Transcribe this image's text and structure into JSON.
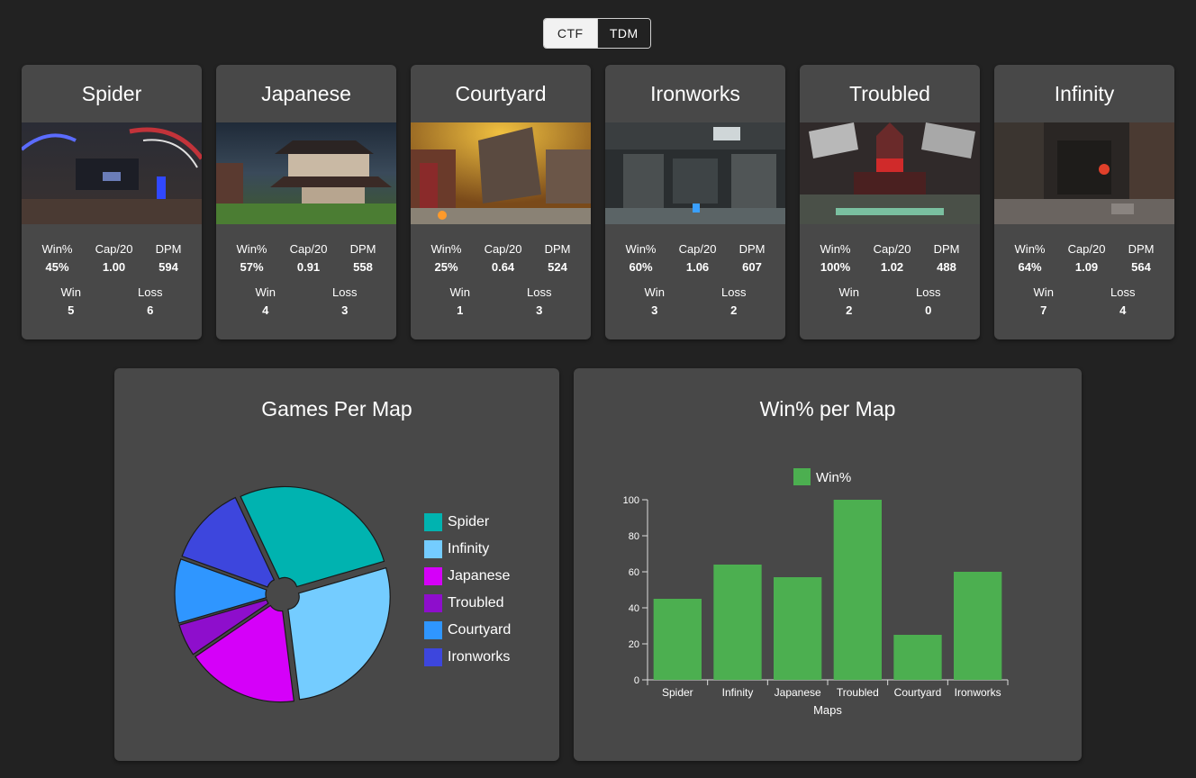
{
  "mode_toggle": {
    "options": [
      "CTF",
      "TDM"
    ],
    "selected": "CTF"
  },
  "maps": [
    {
      "name": "Spider",
      "win_pct": "45%",
      "cap20": "1.00",
      "dpm": "594",
      "win": "5",
      "loss": "6"
    },
    {
      "name": "Japanese",
      "win_pct": "57%",
      "cap20": "0.91",
      "dpm": "558",
      "win": "4",
      "loss": "3"
    },
    {
      "name": "Courtyard",
      "win_pct": "25%",
      "cap20": "0.64",
      "dpm": "524",
      "win": "1",
      "loss": "3"
    },
    {
      "name": "Ironworks",
      "win_pct": "60%",
      "cap20": "1.06",
      "dpm": "607",
      "win": "3",
      "loss": "2"
    },
    {
      "name": "Troubled",
      "win_pct": "100%",
      "cap20": "1.02",
      "dpm": "488",
      "win": "2",
      "loss": "0"
    },
    {
      "name": "Infinity",
      "win_pct": "64%",
      "cap20": "1.09",
      "dpm": "564",
      "win": "7",
      "loss": "4"
    }
  ],
  "stat_labels": {
    "win_pct": "Win%",
    "cap20": "Cap/20",
    "dpm": "DPM",
    "win": "Win",
    "loss": "Loss"
  },
  "chart_data": [
    {
      "type": "pie",
      "title": "Games Per Map",
      "categories": [
        "Spider",
        "Infinity",
        "Japanese",
        "Troubled",
        "Courtyard",
        "Ironworks"
      ],
      "values": [
        11,
        11,
        7,
        2,
        4,
        5
      ],
      "colors": [
        "#00b3b0",
        "#74ccff",
        "#d500f9",
        "#8e0ecc",
        "#2f96ff",
        "#3d46dd"
      ],
      "legend": "right"
    },
    {
      "type": "bar",
      "title": "Win% per Map",
      "categories": [
        "Spider",
        "Infinity",
        "Japanese",
        "Troubled",
        "Courtyard",
        "Ironworks"
      ],
      "series": [
        {
          "name": "Win%",
          "values": [
            45,
            64,
            57,
            100,
            25,
            60
          ],
          "color": "#4caf50"
        }
      ],
      "xlabel": "Maps",
      "ylabel": "",
      "ylim": [
        0,
        100
      ],
      "yticks": [
        0,
        20,
        40,
        60,
        80,
        100
      ],
      "legend": "top"
    }
  ]
}
